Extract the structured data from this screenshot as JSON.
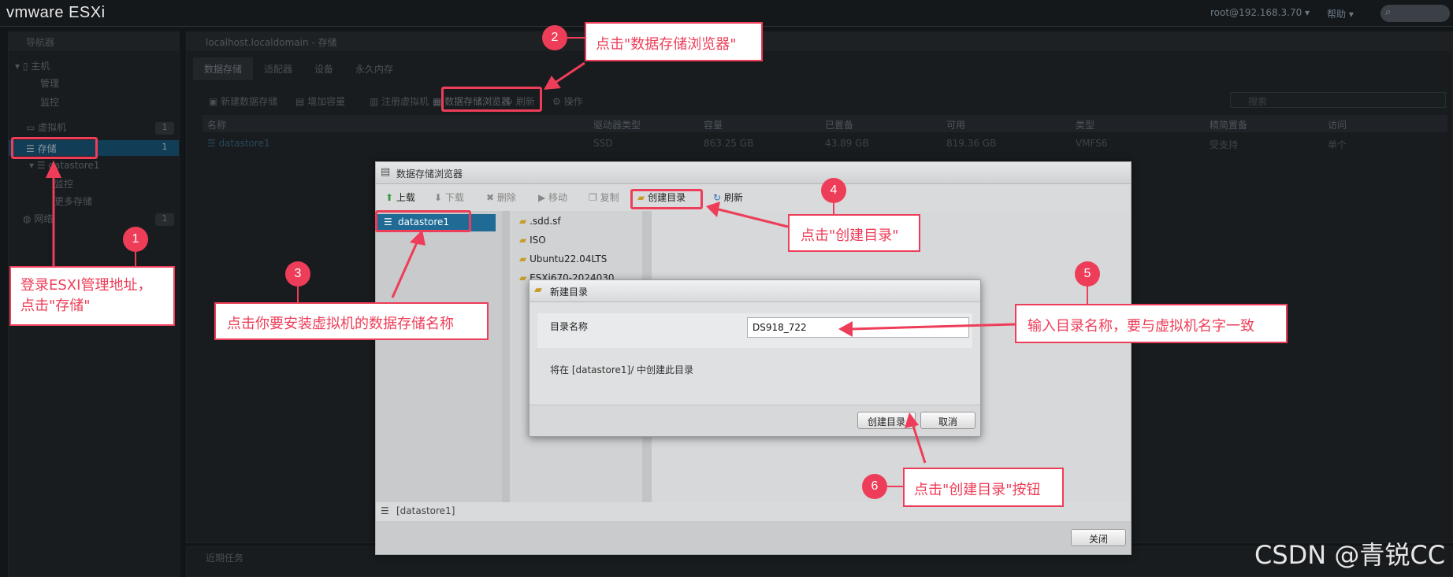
{
  "topbar": {
    "logo": "vmware ESXi",
    "user": "root@192.168.3.70 ▾",
    "help": "帮助 ▾"
  },
  "navigator": {
    "title": "导航器",
    "host": "主机",
    "manage": "管理",
    "monitor": "监控",
    "vms": "虚拟机",
    "vms_count": "1",
    "storage": "存储",
    "storage_count": "1",
    "datastore": "datastore1",
    "ds_monitor": "监控",
    "more_storage": "更多存储",
    "network": "网络",
    "network_count": "1"
  },
  "main": {
    "title": "localhost.localdomain - 存储",
    "tabs": [
      "数据存储",
      "适配器",
      "设备",
      "永久内存"
    ],
    "toolbar": {
      "new_ds": "新建数据存储",
      "add_cap": "增加容量",
      "register_vm": "注册虚拟机",
      "ds_browser": "数据存储浏览器",
      "refresh": "刷新",
      "actions": "操作",
      "search_placeholder": "搜索"
    },
    "columns": [
      "名称",
      "驱动器类型",
      "容量",
      "已置备",
      "可用",
      "类型",
      "精简置备",
      "访问"
    ],
    "row": [
      "datastore1",
      "SSD",
      "863.25 GB",
      "43.89 GB",
      "819.36 GB",
      "VMFS6",
      "受支持",
      "单个"
    ]
  },
  "tasks": {
    "title": "近期任务"
  },
  "browser": {
    "title": "数据存储浏览器",
    "upload": "上载",
    "download": "下载",
    "delete": "删除",
    "move": "移动",
    "copy": "复制",
    "mkdir": "创建目录",
    "refresh": "刷新",
    "datastore": "datastore1",
    "folders": [
      ".sdd.sf",
      "ISO",
      "Ubuntu22.04LTS",
      "ESXi670-2024030"
    ],
    "status": "[datastore1]",
    "close": "关闭"
  },
  "dialog": {
    "title": "新建目录",
    "label": "目录名称",
    "value": "DS918_722",
    "note": "将在 [datastore1]/ 中创建此目录",
    "create": "创建目录",
    "cancel": "取消"
  },
  "annotations": {
    "n1": "1",
    "c1_line1": "登录ESXI管理地址，",
    "c1_line2": "点击\"存储\"",
    "n2": "2",
    "c2": "点击\"数据存储浏览器\"",
    "n3": "3",
    "c3": "点击你要安装虚拟机的数据存储名称",
    "n4": "4",
    "c4": "点击\"创建目录\"",
    "n5": "5",
    "c5": "输入目录名称，要与虚拟机名字一致",
    "n6": "6",
    "c6": "点击\"创建目录\"按钮"
  },
  "watermark": "CSDN @青锐CC",
  "colors": {
    "highlight": "#ee3d58",
    "selection": "#1f6b95"
  }
}
